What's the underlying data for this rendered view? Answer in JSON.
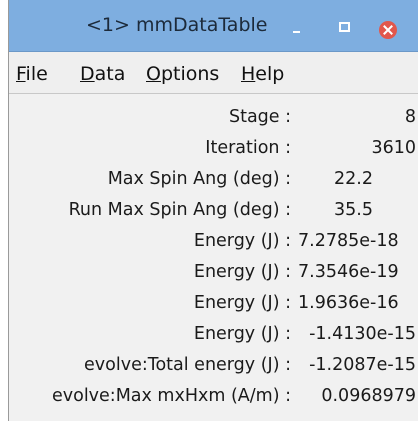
{
  "window": {
    "title": "<1> mmDataTable"
  },
  "menu": {
    "file": {
      "mnemonic": "F",
      "rest": "ile"
    },
    "data": {
      "mnemonic": "D",
      "rest": "ata"
    },
    "options": {
      "mnemonic": "O",
      "rest": "ptions"
    },
    "help": {
      "mnemonic": "H",
      "rest": "elp"
    }
  },
  "rows": [
    {
      "label": "Stage :",
      "value": "8"
    },
    {
      "label": "Iteration :",
      "value": "3610"
    },
    {
      "label": "Max Spin Ang (deg) :",
      "value": "22.2"
    },
    {
      "label": "Run Max Spin Ang (deg) :",
      "value": "35.5"
    },
    {
      "label": "Energy (J) :",
      "value": "7.2785e-18"
    },
    {
      "label": "Energy (J) :",
      "value": "7.3546e-19"
    },
    {
      "label": "Energy (J) :",
      "value": "1.9636e-16"
    },
    {
      "label": "Energy (J) :",
      "value": "-1.4130e-15"
    },
    {
      "label": "evolve:Total energy (J) :",
      "value": "-1.2087e-15"
    },
    {
      "label": "evolve:Max mxHxm (A/m) :",
      "value": "0.0968979"
    }
  ],
  "colors": {
    "titlebar": "#7eaee0",
    "close_button": "#e2574c",
    "window_bg": "#f1f1f1"
  },
  "icons": [
    "minimize-icon",
    "maximize-icon",
    "close-icon"
  ]
}
